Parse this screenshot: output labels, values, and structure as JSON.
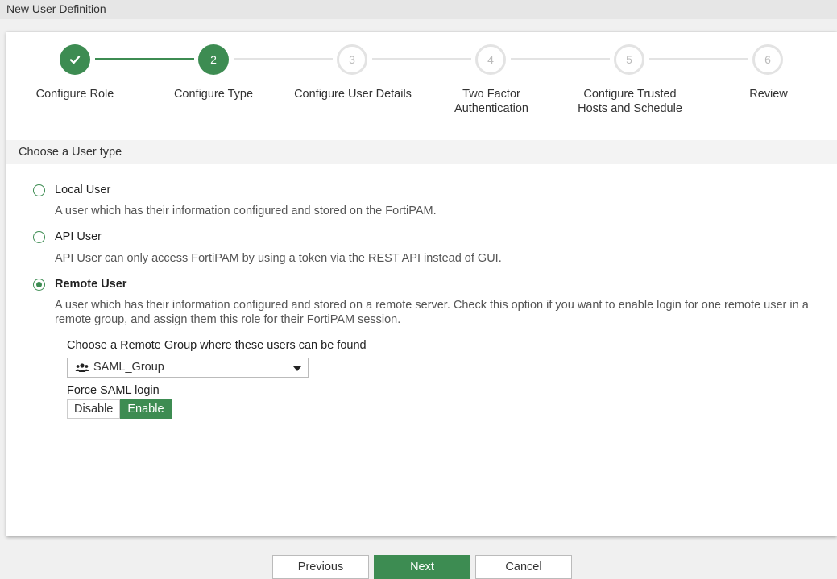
{
  "window": {
    "title": "New User Definition"
  },
  "stepper": {
    "steps": [
      {
        "number": "",
        "label": "Configure Role",
        "state": "done"
      },
      {
        "number": "2",
        "label": "Configure Type",
        "state": "active"
      },
      {
        "number": "3",
        "label": "Configure User Details",
        "state": "todo"
      },
      {
        "number": "4",
        "label_line1": "Two Factor",
        "label_line2": "Authentication",
        "state": "todo"
      },
      {
        "number": "5",
        "label_line1": "Configure Trusted",
        "label_line2": "Hosts and Schedule",
        "state": "todo"
      },
      {
        "number": "6",
        "label": "Review",
        "state": "todo"
      }
    ]
  },
  "section": {
    "title": "Choose a User type"
  },
  "user_types": [
    {
      "label": "Local User",
      "description": "A user which has their information configured and stored on the FortiPAM.",
      "checked": false
    },
    {
      "label": "API User",
      "description": "API User can only access FortiPAM by using a token via the REST API instead of GUI.",
      "checked": false
    },
    {
      "label": "Remote User",
      "description_line1": "A user which has their information configured and stored on a remote server. Check this option if you want to enable login for one remote user in a",
      "description_line2": "remote group, and assign them this role for their FortiPAM session.",
      "checked": true
    }
  ],
  "remote": {
    "group_label": "Choose a Remote Group where these users can be found",
    "group_value": "SAML_Group",
    "force_saml_label": "Force SAML login",
    "toggle_off": "Disable",
    "toggle_on": "Enable",
    "toggle_selected": "Enable"
  },
  "footer": {
    "previous": "Previous",
    "next": "Next",
    "cancel": "Cancel"
  },
  "colors": {
    "accent": "#3d8c52",
    "inactive": "#e3e3e3"
  }
}
